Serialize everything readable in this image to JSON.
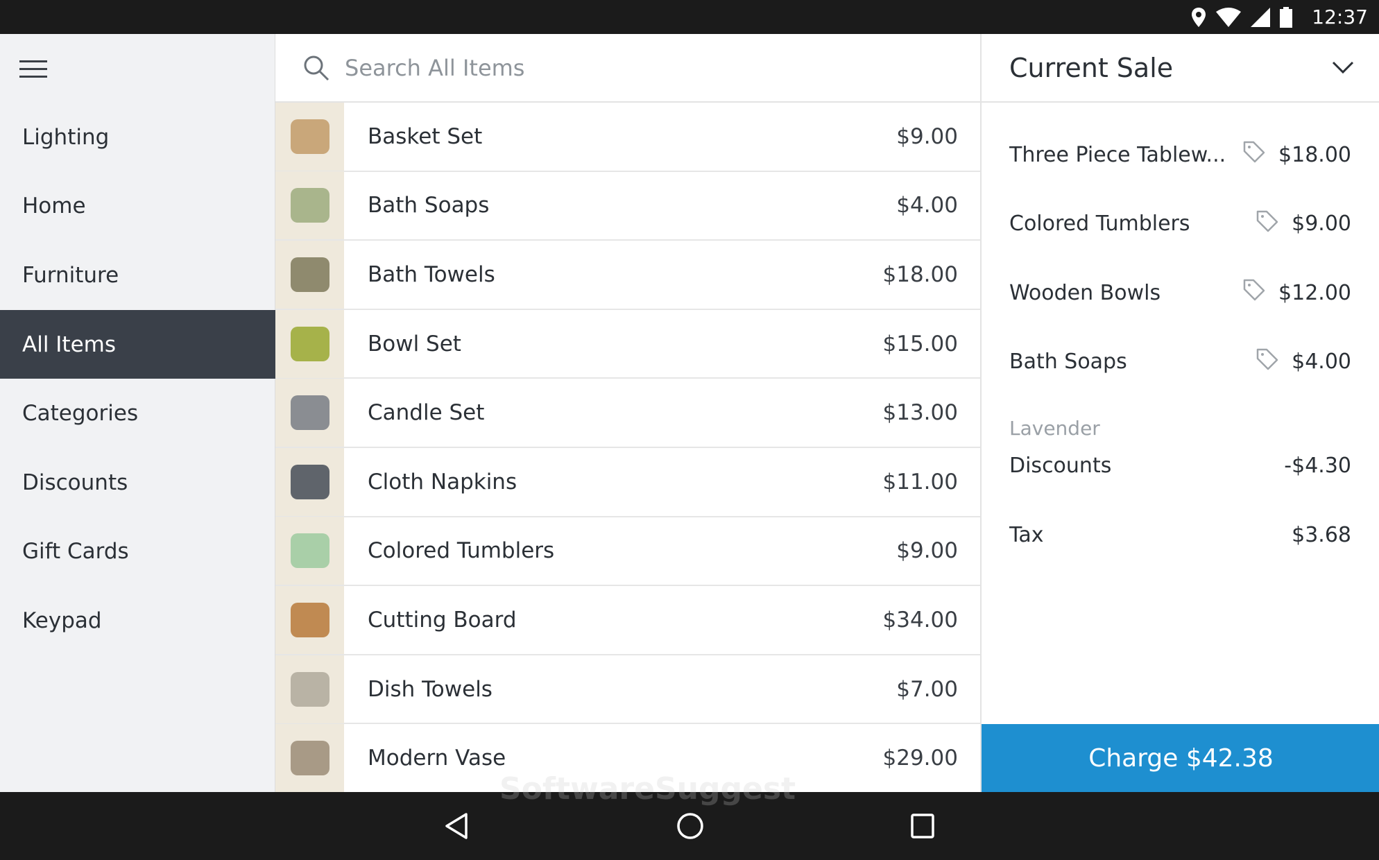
{
  "status_bar": {
    "time": "12:37",
    "icons": [
      "location-icon",
      "wifi-icon",
      "signal-icon",
      "battery-icon"
    ]
  },
  "sidebar": {
    "items": [
      {
        "label": "Lighting"
      },
      {
        "label": "Home"
      },
      {
        "label": "Furniture"
      },
      {
        "label": "All Items",
        "active": true
      },
      {
        "label": "Categories"
      },
      {
        "label": "Discounts"
      },
      {
        "label": "Gift Cards"
      },
      {
        "label": "Keypad"
      }
    ]
  },
  "search": {
    "placeholder": "Search All Items",
    "value": ""
  },
  "items": [
    {
      "name": "Basket Set",
      "price": "$9.00",
      "color": "#c9a77a"
    },
    {
      "name": "Bath Soaps",
      "price": "$4.00",
      "color": "#a9b58c"
    },
    {
      "name": "Bath Towels",
      "price": "$18.00",
      "color": "#8f8a6e"
    },
    {
      "name": "Bowl Set",
      "price": "$15.00",
      "color": "#a6b24a"
    },
    {
      "name": "Candle Set",
      "price": "$13.00",
      "color": "#8a8d92"
    },
    {
      "name": "Cloth Napkins",
      "price": "$11.00",
      "color": "#5f646b"
    },
    {
      "name": "Colored Tumblers",
      "price": "$9.00",
      "color": "#a9cfa8"
    },
    {
      "name": "Cutting Board",
      "price": "$34.00",
      "color": "#c08a52"
    },
    {
      "name": "Dish Towels",
      "price": "$7.00",
      "color": "#b9b3a5"
    },
    {
      "name": "Modern Vase",
      "price": "$29.00",
      "color": "#a89a86"
    }
  ],
  "sale": {
    "title": "Current Sale",
    "lines": [
      {
        "name": "Three Piece Tablew...",
        "price": "$18.00"
      },
      {
        "name": "Colored Tumblers",
        "price": "$9.00"
      },
      {
        "name": "Wooden Bowls",
        "price": "$12.00"
      },
      {
        "name": "Bath Soaps",
        "price": "$4.00",
        "variant": "Lavender"
      }
    ],
    "discounts_label": "Discounts",
    "discounts_value": "-$4.30",
    "tax_label": "Tax",
    "tax_value": "$3.68",
    "charge_label": "Charge $42.38",
    "accent": "#1e8fd0"
  },
  "watermark": "SoftwareSuggest"
}
